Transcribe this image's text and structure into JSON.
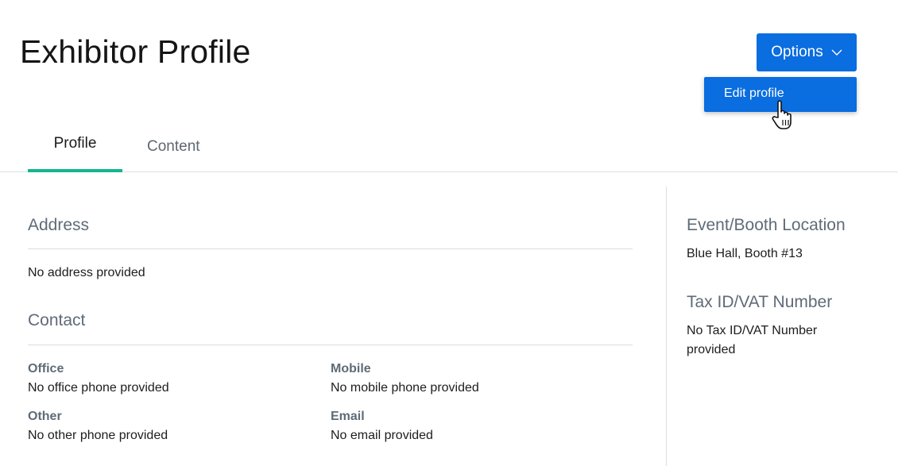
{
  "page": {
    "title": "Exhibitor Profile"
  },
  "options_button": {
    "label": "Options",
    "menu": {
      "items": [
        "Edit profile"
      ]
    }
  },
  "tabs": [
    {
      "label": "Profile",
      "active": true
    },
    {
      "label": "Content",
      "active": false
    }
  ],
  "address": {
    "title": "Address",
    "value": "No address provided"
  },
  "contact": {
    "title": "Contact",
    "fields": [
      {
        "label": "Office",
        "value": "No office phone provided"
      },
      {
        "label": "Mobile",
        "value": "No mobile phone provided"
      },
      {
        "label": "Other",
        "value": "No other phone provided"
      },
      {
        "label": "Email",
        "value": "No email provided"
      }
    ]
  },
  "sidebar": {
    "booth": {
      "title": "Event/Booth Location",
      "value": "Blue Hall, Booth #13"
    },
    "tax": {
      "title": "Tax ID/VAT Number",
      "value_line1": "No Tax ID/VAT Number",
      "value_line2": "provided"
    }
  },
  "colors": {
    "primary": "#0a6de0",
    "tab_active_underline": "#13b58f",
    "muted_text": "#5f6b77"
  },
  "icons": {
    "dropdown": "chevron-down-icon",
    "cursor": "hand-pointer-icon"
  }
}
